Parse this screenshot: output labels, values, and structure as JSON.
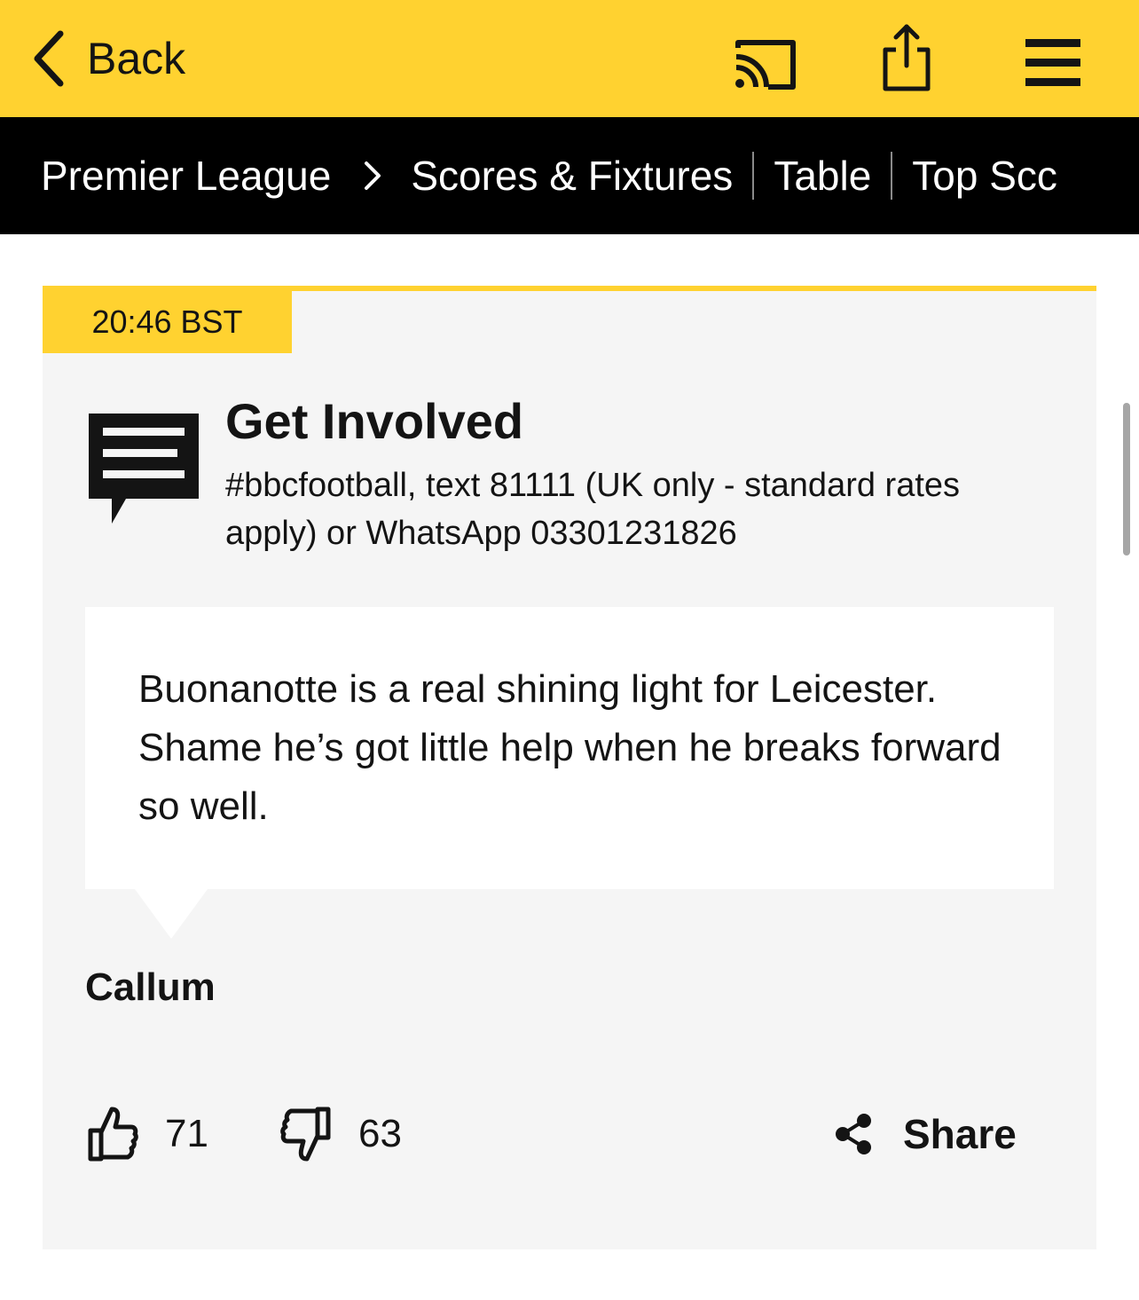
{
  "header": {
    "back_label": "Back",
    "icons": [
      "cast-icon",
      "share-icon",
      "menu-icon"
    ],
    "background_color": "#ffd230"
  },
  "nav": {
    "breadcrumb": "Premier League",
    "links": [
      "Scores & Fixtures",
      "Table",
      "Top Scc"
    ],
    "background_color": "#000000"
  },
  "post": {
    "timestamp": "20:46 BST",
    "title": "Get Involved",
    "subtitle": "#bbcfootball, text 81111 (UK only - standard rates apply) or WhatsApp 03301231826",
    "quote": "Buonanotte is a real shining light for Leicester. Shame he’s got little help when he breaks forward so well.",
    "author": "Callum",
    "likes": "71",
    "dislikes": "63",
    "share_label": "Share",
    "accent_color": "#ffd230"
  }
}
